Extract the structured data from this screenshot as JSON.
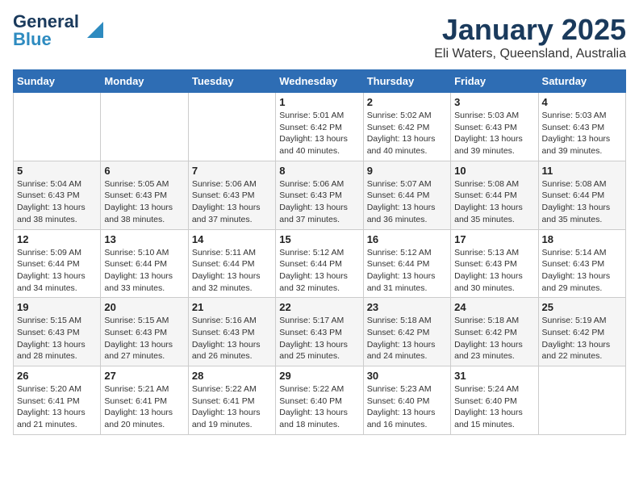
{
  "logo": {
    "line1": "General",
    "line2": "Blue"
  },
  "title": "January 2025",
  "location": "Eli Waters, Queensland, Australia",
  "days_header": [
    "Sunday",
    "Monday",
    "Tuesday",
    "Wednesday",
    "Thursday",
    "Friday",
    "Saturday"
  ],
  "weeks": [
    [
      {
        "day": "",
        "info": ""
      },
      {
        "day": "",
        "info": ""
      },
      {
        "day": "",
        "info": ""
      },
      {
        "day": "1",
        "info": "Sunrise: 5:01 AM\nSunset: 6:42 PM\nDaylight: 13 hours\nand 40 minutes."
      },
      {
        "day": "2",
        "info": "Sunrise: 5:02 AM\nSunset: 6:42 PM\nDaylight: 13 hours\nand 40 minutes."
      },
      {
        "day": "3",
        "info": "Sunrise: 5:03 AM\nSunset: 6:43 PM\nDaylight: 13 hours\nand 39 minutes."
      },
      {
        "day": "4",
        "info": "Sunrise: 5:03 AM\nSunset: 6:43 PM\nDaylight: 13 hours\nand 39 minutes."
      }
    ],
    [
      {
        "day": "5",
        "info": "Sunrise: 5:04 AM\nSunset: 6:43 PM\nDaylight: 13 hours\nand 38 minutes."
      },
      {
        "day": "6",
        "info": "Sunrise: 5:05 AM\nSunset: 6:43 PM\nDaylight: 13 hours\nand 38 minutes."
      },
      {
        "day": "7",
        "info": "Sunrise: 5:06 AM\nSunset: 6:43 PM\nDaylight: 13 hours\nand 37 minutes."
      },
      {
        "day": "8",
        "info": "Sunrise: 5:06 AM\nSunset: 6:43 PM\nDaylight: 13 hours\nand 37 minutes."
      },
      {
        "day": "9",
        "info": "Sunrise: 5:07 AM\nSunset: 6:44 PM\nDaylight: 13 hours\nand 36 minutes."
      },
      {
        "day": "10",
        "info": "Sunrise: 5:08 AM\nSunset: 6:44 PM\nDaylight: 13 hours\nand 35 minutes."
      },
      {
        "day": "11",
        "info": "Sunrise: 5:08 AM\nSunset: 6:44 PM\nDaylight: 13 hours\nand 35 minutes."
      }
    ],
    [
      {
        "day": "12",
        "info": "Sunrise: 5:09 AM\nSunset: 6:44 PM\nDaylight: 13 hours\nand 34 minutes."
      },
      {
        "day": "13",
        "info": "Sunrise: 5:10 AM\nSunset: 6:44 PM\nDaylight: 13 hours\nand 33 minutes."
      },
      {
        "day": "14",
        "info": "Sunrise: 5:11 AM\nSunset: 6:44 PM\nDaylight: 13 hours\nand 32 minutes."
      },
      {
        "day": "15",
        "info": "Sunrise: 5:12 AM\nSunset: 6:44 PM\nDaylight: 13 hours\nand 32 minutes."
      },
      {
        "day": "16",
        "info": "Sunrise: 5:12 AM\nSunset: 6:44 PM\nDaylight: 13 hours\nand 31 minutes."
      },
      {
        "day": "17",
        "info": "Sunrise: 5:13 AM\nSunset: 6:43 PM\nDaylight: 13 hours\nand 30 minutes."
      },
      {
        "day": "18",
        "info": "Sunrise: 5:14 AM\nSunset: 6:43 PM\nDaylight: 13 hours\nand 29 minutes."
      }
    ],
    [
      {
        "day": "19",
        "info": "Sunrise: 5:15 AM\nSunset: 6:43 PM\nDaylight: 13 hours\nand 28 minutes."
      },
      {
        "day": "20",
        "info": "Sunrise: 5:15 AM\nSunset: 6:43 PM\nDaylight: 13 hours\nand 27 minutes."
      },
      {
        "day": "21",
        "info": "Sunrise: 5:16 AM\nSunset: 6:43 PM\nDaylight: 13 hours\nand 26 minutes."
      },
      {
        "day": "22",
        "info": "Sunrise: 5:17 AM\nSunset: 6:43 PM\nDaylight: 13 hours\nand 25 minutes."
      },
      {
        "day": "23",
        "info": "Sunrise: 5:18 AM\nSunset: 6:42 PM\nDaylight: 13 hours\nand 24 minutes."
      },
      {
        "day": "24",
        "info": "Sunrise: 5:18 AM\nSunset: 6:42 PM\nDaylight: 13 hours\nand 23 minutes."
      },
      {
        "day": "25",
        "info": "Sunrise: 5:19 AM\nSunset: 6:42 PM\nDaylight: 13 hours\nand 22 minutes."
      }
    ],
    [
      {
        "day": "26",
        "info": "Sunrise: 5:20 AM\nSunset: 6:41 PM\nDaylight: 13 hours\nand 21 minutes."
      },
      {
        "day": "27",
        "info": "Sunrise: 5:21 AM\nSunset: 6:41 PM\nDaylight: 13 hours\nand 20 minutes."
      },
      {
        "day": "28",
        "info": "Sunrise: 5:22 AM\nSunset: 6:41 PM\nDaylight: 13 hours\nand 19 minutes."
      },
      {
        "day": "29",
        "info": "Sunrise: 5:22 AM\nSunset: 6:40 PM\nDaylight: 13 hours\nand 18 minutes."
      },
      {
        "day": "30",
        "info": "Sunrise: 5:23 AM\nSunset: 6:40 PM\nDaylight: 13 hours\nand 16 minutes."
      },
      {
        "day": "31",
        "info": "Sunrise: 5:24 AM\nSunset: 6:40 PM\nDaylight: 13 hours\nand 15 minutes."
      },
      {
        "day": "",
        "info": ""
      }
    ]
  ]
}
